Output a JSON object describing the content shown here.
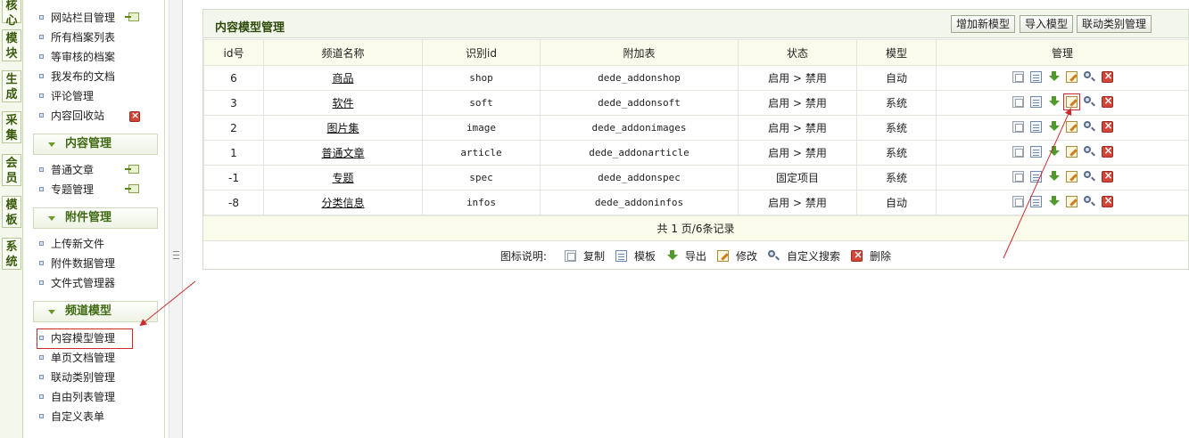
{
  "side_tabs": [
    "核心",
    "模块",
    "生成",
    "采集",
    "会员",
    "模板",
    "系统"
  ],
  "menu": {
    "items_top": [
      "网站栏目管理",
      "所有档案列表",
      "等审核的档案",
      "我发布的文档",
      "评论管理",
      "内容回收站"
    ],
    "group_content": "内容管理",
    "items_content": [
      "普通文章",
      "专题管理"
    ],
    "group_attach": "附件管理",
    "items_attach": [
      "上传新文件",
      "附件数据管理",
      "文件式管理器"
    ],
    "group_channel": "频道模型",
    "items_channel": [
      "内容模型管理",
      "单页文档管理",
      "联动类别管理",
      "自由列表管理",
      "自定义表单"
    ]
  },
  "main": {
    "title": "内容模型管理",
    "buttons": [
      "增加新模型",
      "导入模型",
      "联动类别管理"
    ],
    "columns": [
      "id号",
      "频道名称",
      "识别id",
      "附加表",
      "状态",
      "模型",
      "管理"
    ],
    "rows": [
      {
        "id": "6",
        "name": "商品",
        "nid": "shop",
        "table": "dede_addonshop",
        "status": "启用 > 禁用",
        "model": "自动"
      },
      {
        "id": "3",
        "name": "软件",
        "nid": "soft",
        "table": "dede_addonsoft",
        "status": "启用 > 禁用",
        "model": "系统"
      },
      {
        "id": "2",
        "name": "图片集",
        "nid": "image",
        "table": "dede_addonimages",
        "status": "启用 > 禁用",
        "model": "系统"
      },
      {
        "id": "1",
        "name": "普通文章",
        "nid": "article",
        "table": "dede_addonarticle",
        "status": "启用 > 禁用",
        "model": "系统"
      },
      {
        "id": "-1",
        "name": "专题",
        "nid": "spec",
        "table": "dede_addonspec",
        "status": "固定项目",
        "model": "系统"
      },
      {
        "id": "-8",
        "name": "分类信息",
        "nid": "infos",
        "table": "dede_addoninfos",
        "status": "启用 > 禁用",
        "model": "自动"
      }
    ],
    "pager": "共 1 页/6条记录",
    "legend": {
      "label": "图标说明:",
      "items": [
        {
          "icon": "copy-icon",
          "text": "复制"
        },
        {
          "icon": "template-icon",
          "text": "模板"
        },
        {
          "icon": "export-icon",
          "text": "导出"
        },
        {
          "icon": "edit-icon",
          "text": "修改"
        },
        {
          "icon": "search-icon",
          "text": "自定义搜索"
        },
        {
          "icon": "delete-icon",
          "text": "删除"
        }
      ]
    }
  },
  "colors": {
    "accent": "#3f6a12",
    "highlight": "#cc2b2b",
    "header_bg": "#fbfbeb"
  }
}
